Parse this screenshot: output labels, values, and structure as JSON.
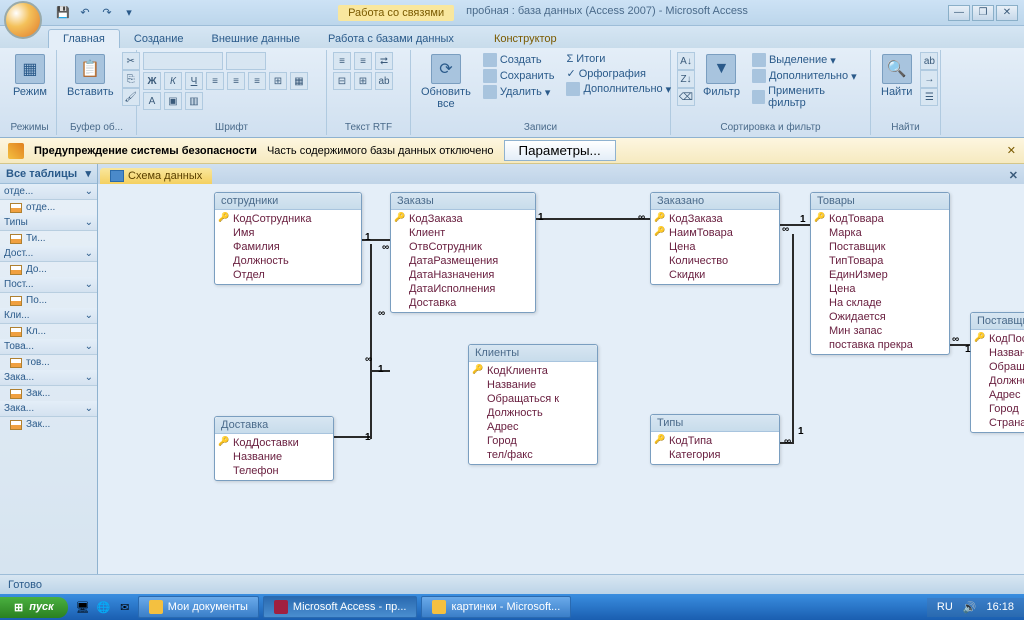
{
  "titlebar": {
    "context_label": "Работа со связями",
    "app_title": "пробная : база данных (Access 2007) - Microsoft Access"
  },
  "ribbon_tabs": [
    "Главная",
    "Создание",
    "Внешние данные",
    "Работа с базами данных",
    "Конструктор"
  ],
  "ribbon": {
    "group1": "Режимы",
    "group2": "Буфер об...",
    "group3": "Шрифт",
    "group4": "Текст RTF",
    "group5": "Записи",
    "group6": "Сортировка и фильтр",
    "group7": "Найти",
    "btn_view": "Режим",
    "btn_paste": "Вставить",
    "btn_refresh": "Обновить\nвсе",
    "btn_new": "Создать",
    "btn_save": "Сохранить",
    "btn_delete": "Удалить",
    "btn_totals": "Итоги",
    "btn_spell": "Орфография",
    "btn_more": "Дополнительно",
    "btn_filter": "Фильтр",
    "btn_sel": "Выделение",
    "btn_adv": "Дополнительно",
    "btn_toggle": "Применить фильтр",
    "btn_find": "Найти"
  },
  "security": {
    "title": "Предупреждение системы безопасности",
    "msg": "Часть содержимого базы данных отключено",
    "params": "Параметры..."
  },
  "nav": {
    "header": "Все таблицы",
    "groups": [
      {
        "title": "отде...",
        "items": [
          "отде..."
        ]
      },
      {
        "title": "Типы",
        "items": [
          "Ти..."
        ]
      },
      {
        "title": "Дост...",
        "items": [
          "До..."
        ]
      },
      {
        "title": "Пост...",
        "items": [
          "По..."
        ]
      },
      {
        "title": "Кли...",
        "items": [
          "Кл..."
        ]
      },
      {
        "title": "Това...",
        "items": [
          "тов..."
        ]
      },
      {
        "title": "Зака...",
        "items": [
          "Зак..."
        ]
      },
      {
        "title": "Зака...",
        "items": [
          "Зак..."
        ]
      }
    ]
  },
  "doc_tab": "Схема данных",
  "tables": {
    "sotrudniki": {
      "title": "сотрудники",
      "fields": [
        {
          "n": "КодСотрудника",
          "k": true
        },
        {
          "n": "Имя"
        },
        {
          "n": "Фамилия"
        },
        {
          "n": "Должность"
        },
        {
          "n": "Отдел"
        }
      ]
    },
    "zakazy": {
      "title": "Заказы",
      "fields": [
        {
          "n": "КодЗаказа",
          "k": true
        },
        {
          "n": "Клиент"
        },
        {
          "n": "ОтвСотрудник"
        },
        {
          "n": "ДатаРазмещения"
        },
        {
          "n": "ДатаНазначения"
        },
        {
          "n": "ДатаИсполнения"
        },
        {
          "n": "Доставка"
        }
      ]
    },
    "zakazano": {
      "title": "Заказано",
      "fields": [
        {
          "n": "КодЗаказа",
          "k": true
        },
        {
          "n": "НаимТовара",
          "k": true
        },
        {
          "n": "Цена"
        },
        {
          "n": "Количество"
        },
        {
          "n": "Скидки"
        }
      ]
    },
    "tovary": {
      "title": "Товары",
      "fields": [
        {
          "n": "КодТовара",
          "k": true
        },
        {
          "n": "Марка"
        },
        {
          "n": "Поставщик"
        },
        {
          "n": "ТипТовара"
        },
        {
          "n": "ЕдинИзмер"
        },
        {
          "n": "Цена"
        },
        {
          "n": "На складе"
        },
        {
          "n": "Ожидается"
        },
        {
          "n": "Мин запас"
        },
        {
          "n": "поставка прекра"
        }
      ]
    },
    "postavshiki": {
      "title": "Поставщики",
      "fields": [
        {
          "n": "КодПоставщика",
          "k": true
        },
        {
          "n": "Название"
        },
        {
          "n": "Обращаться к"
        },
        {
          "n": "Должность"
        },
        {
          "n": "Адрес"
        },
        {
          "n": "Город"
        },
        {
          "n": "Страна"
        }
      ]
    },
    "dostavka": {
      "title": "Доставка",
      "fields": [
        {
          "n": "КодДоставки",
          "k": true
        },
        {
          "n": "Название"
        },
        {
          "n": "Телефон"
        }
      ]
    },
    "klienty": {
      "title": "Клиенты",
      "fields": [
        {
          "n": "КодКлиента",
          "k": true
        },
        {
          "n": "Название"
        },
        {
          "n": "Обращаться к"
        },
        {
          "n": "Должность"
        },
        {
          "n": "Адрес"
        },
        {
          "n": "Город"
        },
        {
          "n": "тел/факс"
        }
      ]
    },
    "tipy": {
      "title": "Типы",
      "fields": [
        {
          "n": "КодТипа",
          "k": true
        },
        {
          "n": "Категория"
        }
      ]
    }
  },
  "status": "Готово",
  "taskbar": {
    "start": "пуск",
    "items": [
      "Мои документы",
      "Microsoft Access - пр...",
      "картинки - Microsoft..."
    ],
    "lang": "RU",
    "time": "16:18"
  }
}
